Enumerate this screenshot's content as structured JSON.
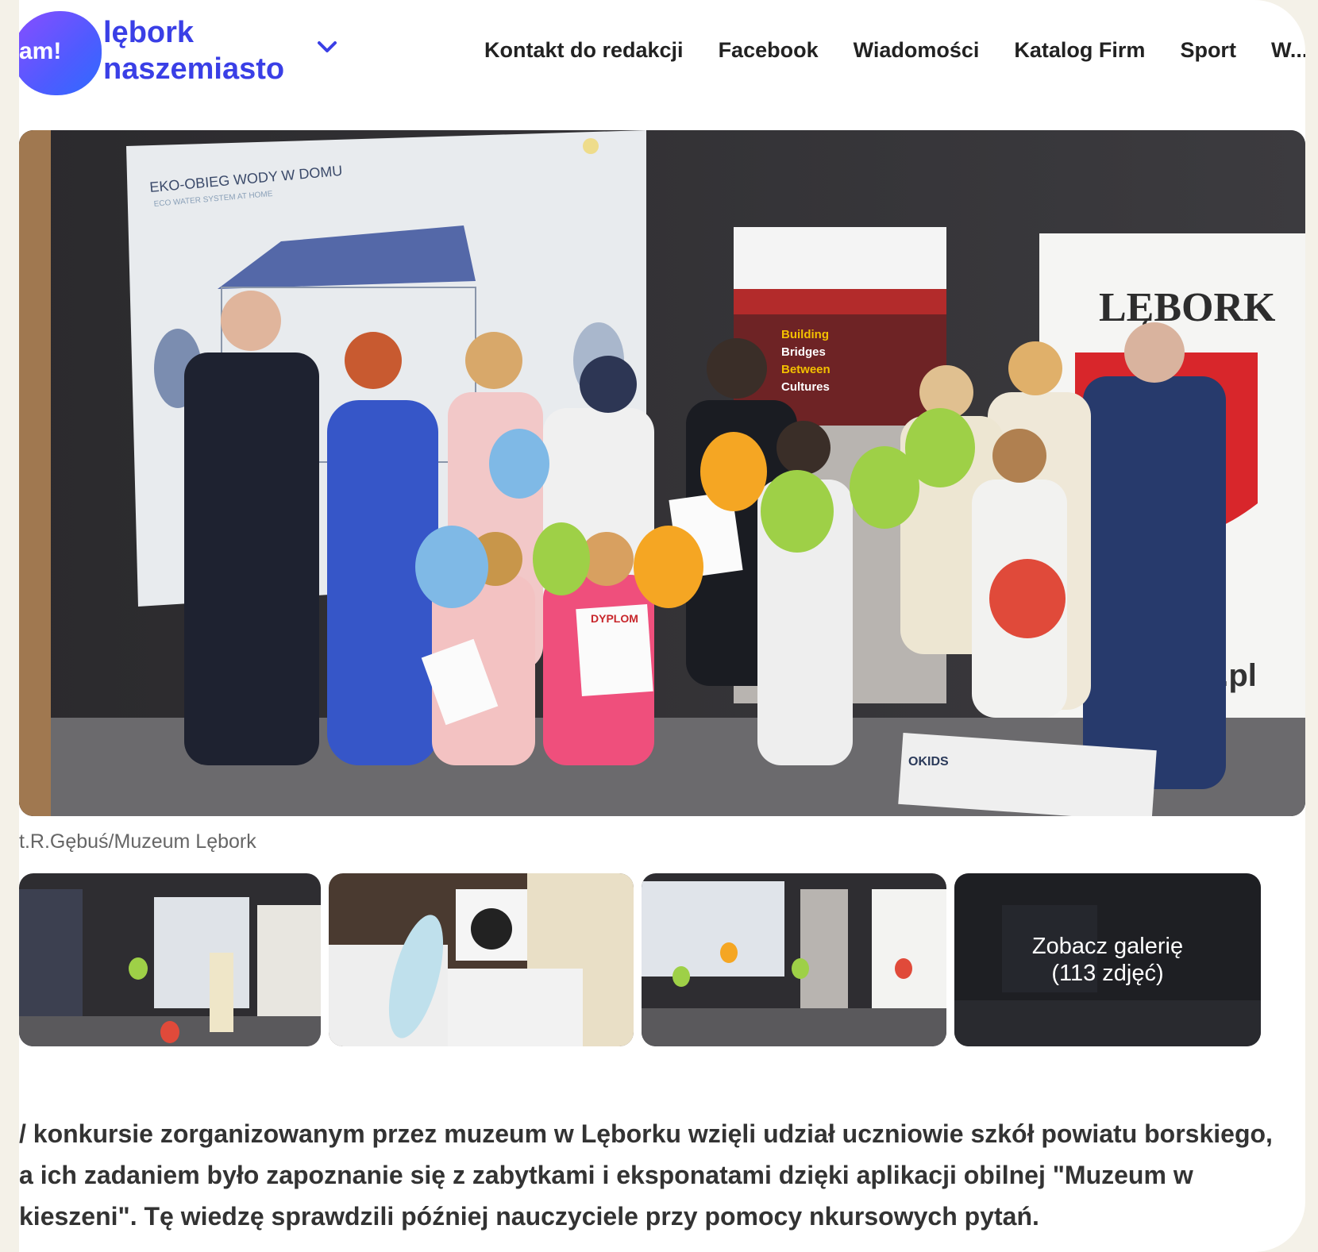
{
  "header": {
    "logo_mark": "am!",
    "brand_line1": "lębork",
    "brand_line2": "naszemiasto",
    "nav": [
      "Kontakt do redakcji",
      "Facebook",
      "Wiadomości",
      "Katalog Firm",
      "Sport",
      "W..."
    ]
  },
  "hero": {
    "poster_title": "EKO-OBIEG WODY W DOMU",
    "poster_subtitle": "ECO WATER SYSTEM AT HOME",
    "banner_text": [
      "Building",
      "Bridges",
      "Between",
      "Cultures"
    ],
    "city_banner": "LĘBORK",
    "city_url_fragment": "k.pl",
    "diploma_label": "DYPLOM",
    "box_label": "OKIDS"
  },
  "caption": "t.R.Gębuś/Muzeum Lębork",
  "gallery": {
    "cta_line1": "Zobacz galerię",
    "cta_line2": "(113 zdjęć)"
  },
  "lead": "/ konkursie zorganizowanym przez muzeum w Lęborku wzięli udział uczniowie szkół powiatu borskiego, a ich zadaniem było zapoznanie się z zabytkami i eksponatami dzięki aplikacji obilnej \"Muzeum w kieszeni\". Tę wiedzę sprawdzili później nauczyciele przy pomocy nkursowych pytań.",
  "colors": {
    "brand": "#3a3fe6",
    "balloon_blue": "#7fb9e6",
    "balloon_green": "#9ed047",
    "balloon_orange": "#f5a623",
    "balloon_red": "#e04a3a"
  }
}
